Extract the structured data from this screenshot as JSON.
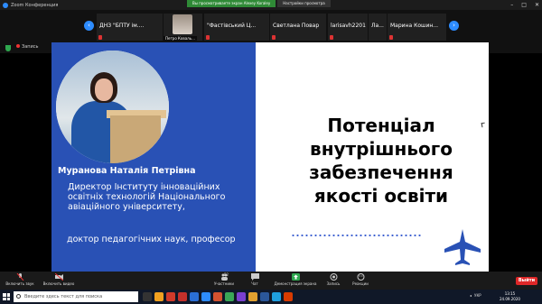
{
  "window": {
    "title": "Zoom Конференция"
  },
  "view_controls": {
    "notice": "Вы просматриваете экран Alexey Koraley",
    "options": "Настройки просмотра"
  },
  "participants": [
    {
      "name": "ДНЗ \"БПТУ ім...."
    },
    {
      "name": "Петро Коваль..."
    },
    {
      "name": "\"Фастівський Ц..."
    },
    {
      "name": "Светлана Повар"
    },
    {
      "name": "larisavh2201"
    },
    {
      "name": "Ла..."
    },
    {
      "name": "Марина Кошин..."
    }
  ],
  "recording": {
    "label": "Запись"
  },
  "slide": {
    "name": "Муранова Наталія Петрівна",
    "position": "Директор Інституту інноваційних освітніх технологій Національного авіаційного університету,",
    "degree": "доктор педагогічних наук, професор",
    "title": "Потенціал внутрішнього забезпечення якості освіти"
  },
  "toolbar": {
    "audio": "Включить звук",
    "video": "Включить видео",
    "participants": "Участники",
    "participants_count": "52",
    "chat": "Чат",
    "share": "Демонстрация экрана",
    "record": "Запись",
    "reactions": "Реакции",
    "exit": "Выйти"
  },
  "taskbar": {
    "search_placeholder": "Введите здесь текст для поиска",
    "time": "13:15",
    "date": "24.09.2020",
    "lang": "УКР"
  },
  "colors": {
    "slide_blue": "#2951b5",
    "zoom_blue": "#2d8cff",
    "share_green": "#2fa84f",
    "exit_red": "#e02828"
  }
}
